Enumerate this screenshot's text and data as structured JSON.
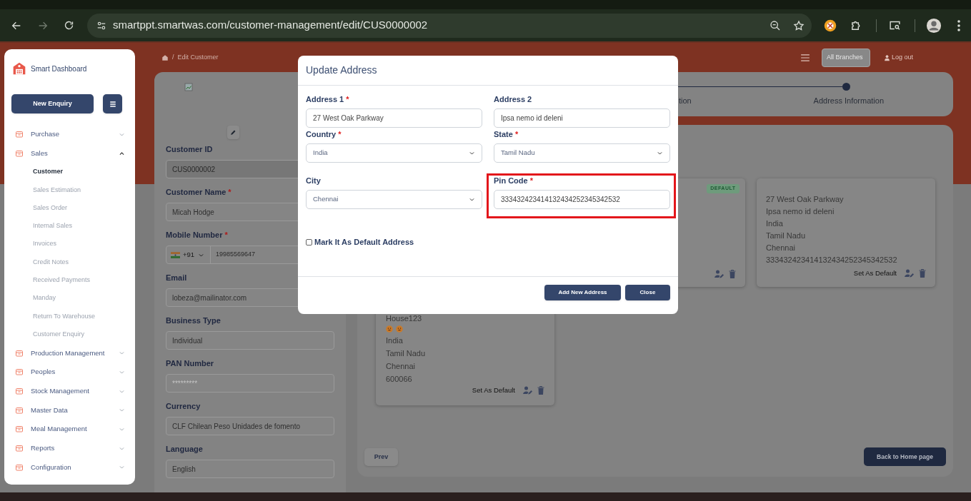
{
  "browser": {
    "url": "smartppt.smartwas.com/customer-management/edit/CUS0000002"
  },
  "sidebar": {
    "brand": "Smart Dashboard",
    "new_button": "New Enquiry",
    "items": [
      {
        "label": "Purchase",
        "expanded": false
      },
      {
        "label": "Sales",
        "expanded": true,
        "children": [
          {
            "label": "Customer",
            "selected": true
          },
          {
            "label": "Sales Estimation",
            "selected": false
          },
          {
            "label": "Sales Order",
            "selected": false
          },
          {
            "label": "Internal Sales",
            "selected": false
          },
          {
            "label": "Invoices",
            "selected": false
          },
          {
            "label": "Credit Notes",
            "selected": false
          },
          {
            "label": "Received Payments",
            "selected": false
          },
          {
            "label": "Manday",
            "selected": false
          },
          {
            "label": "Return To Warehouse",
            "selected": false
          },
          {
            "label": "Customer Enquiry",
            "selected": false
          }
        ]
      },
      {
        "label": "Production Management",
        "expanded": false
      },
      {
        "label": "Peoples",
        "expanded": false
      },
      {
        "label": "Stock Management",
        "expanded": false
      },
      {
        "label": "Master Data",
        "expanded": false
      },
      {
        "label": "Meal Management",
        "expanded": false
      },
      {
        "label": "Reports",
        "expanded": false
      },
      {
        "label": "Configuration",
        "expanded": false
      }
    ]
  },
  "topbar": {
    "separator": "/",
    "breadcrumb": "Edit Customer",
    "branch_select": "All Branches",
    "logout": "Log out"
  },
  "customer_form": {
    "fields": [
      {
        "kind": "text",
        "label": "Customer ID",
        "value": "CUS0000002",
        "disabled": true
      },
      {
        "kind": "text",
        "label": "Customer Name",
        "required_mark": "*",
        "value": "Micah Hodge",
        "disabled": false
      },
      {
        "kind": "phone",
        "label": "Mobile Number",
        "required_mark": "*",
        "country_code": "+91",
        "value": "19985569647",
        "disabled": false
      },
      {
        "kind": "text",
        "label": "Email",
        "value": "lobeza@mailinator.com",
        "disabled": false
      },
      {
        "kind": "text",
        "label": "Business Type",
        "value": "Individual",
        "disabled": false
      },
      {
        "kind": "text",
        "label": "PAN Number",
        "placeholder": "*********",
        "disabled": false
      },
      {
        "kind": "text",
        "label": "Currency",
        "value": "CLF Chilean Peso Unidades de fomento",
        "disabled": false
      },
      {
        "kind": "text",
        "label": "Language",
        "value": "English",
        "disabled": false
      }
    ]
  },
  "stepper": {
    "steps": [
      {
        "label": "tion"
      },
      {
        "label": "Address Information"
      }
    ]
  },
  "addresses": {
    "cards": [
      {
        "is_default": false,
        "action": "Set As Default",
        "lines": [
          {
            "kind": "text",
            "text": "House123"
          },
          {
            "kind": "smileys"
          },
          {
            "kind": "text",
            "text": "India"
          },
          {
            "kind": "text",
            "text": "Tamil Nadu"
          },
          {
            "kind": "text",
            "text": "Chennai"
          },
          {
            "kind": "text",
            "text": "600066"
          }
        ]
      },
      {
        "is_default": true,
        "badge": "DEFAULT"
      },
      {
        "is_default": false,
        "action": "Set As Default",
        "lines": [
          {
            "kind": "text",
            "text": "27 West Oak Parkway"
          },
          {
            "kind": "text",
            "text": "Ipsa nemo id deleni"
          },
          {
            "kind": "text",
            "text": "India"
          },
          {
            "kind": "text",
            "text": "Tamil Nadu"
          },
          {
            "kind": "text",
            "text": "Chennai"
          },
          {
            "kind": "text",
            "text": "333432423414132434252345342532"
          }
        ]
      }
    ],
    "prev_button": "Prev",
    "home_button": "Back to Home page"
  },
  "modal": {
    "title": "Update Address",
    "fields": [
      {
        "kind": "input",
        "label": "Address 1",
        "required_mark": "*",
        "value": "27 West Oak Parkway",
        "highlighted": false
      },
      {
        "kind": "input",
        "label": "Address 2",
        "value": "Ipsa nemo id deleni",
        "highlighted": false
      },
      {
        "kind": "select",
        "label": "Country",
        "required_mark": "*",
        "value": "India",
        "highlighted": false
      },
      {
        "kind": "select",
        "label": "State",
        "required_mark": "*",
        "value": "Tamil Nadu",
        "highlighted": false
      },
      {
        "kind": "select",
        "label": "City",
        "value": "Chennai",
        "highlighted": false
      },
      {
        "kind": "input",
        "label": "Pin Code",
        "required_mark": "*",
        "value": "333432423414132434252345342532",
        "highlighted": true
      }
    ],
    "default_checkbox": {
      "label": "Mark It As Default Address",
      "checked": false
    },
    "buttons": [
      "Add New Address",
      "Close"
    ]
  }
}
